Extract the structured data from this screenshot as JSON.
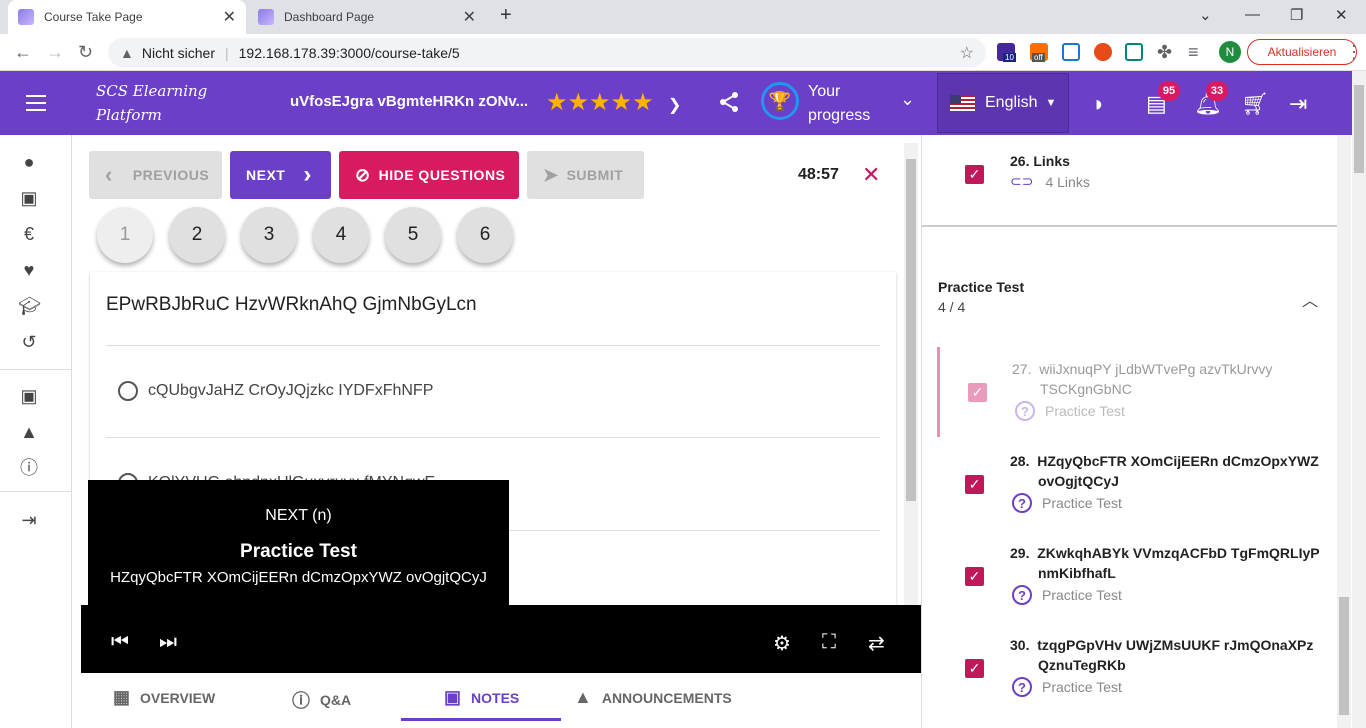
{
  "browser": {
    "tabs": [
      {
        "title": "Course Take Page",
        "active": true
      },
      {
        "title": "Dashboard Page",
        "active": false
      }
    ],
    "security": "Nicht sicher",
    "url": "192.168.178.39:3000/course-take/5",
    "update_label": "Aktualisieren",
    "profile_initial": "N",
    "ext_badge_1": "10",
    "ext_badge_2": "off"
  },
  "header": {
    "brand_line1": "SCS Elearning",
    "brand_line2": "Platform",
    "course_title": "uVfosEJgra vBgmteHRKn zONv...",
    "rating_stars": "★★★★★",
    "progress_line1": "Your",
    "progress_line2": "progress",
    "language": "English",
    "messages_count": "95",
    "notifications_count": "33"
  },
  "controls": {
    "previous_label": "PREVIOUS",
    "next_label": "NEXT",
    "hide_questions_label": "HIDE QUESTIONS",
    "submit_label": "SUBMIT",
    "timer": "48:57",
    "question_numbers": [
      "1",
      "2",
      "3",
      "4",
      "5",
      "6"
    ]
  },
  "question": {
    "title": "EPwRBJbRuC HzvWRknAhQ GjmNbGyLcn",
    "options": [
      "cQUbgvJaHZ CrOyJQjzkc IYDFxFhNFP",
      "KOlYVUG ebndnxUlGuxyruyx fMYNqwE"
    ]
  },
  "tooltip": {
    "shortcut": "NEXT (n)",
    "title": "Practice Test",
    "subtitle": "HZqyQbcFTR XOmCijEERn dCmzOpxYWZ ovOgjtQCyJ"
  },
  "bottom_tabs": [
    {
      "label": "OVERVIEW"
    },
    {
      "label": "Q&A"
    },
    {
      "label": "NOTES"
    },
    {
      "label": "ANNOUNCEMENTS"
    }
  ],
  "curriculum": {
    "prev_item": {
      "num": "26.",
      "title": "Links",
      "sub": "4  Links"
    },
    "section": {
      "title": "Practice Test",
      "count": "4 / 4"
    },
    "items": [
      {
        "num": "27.",
        "title_line1": "wiiJxnuqPY jLdbWTvePg azvTkUrvvy",
        "title_line2": "TSCKgnGbNC",
        "sub": "Practice Test"
      },
      {
        "num": "28.",
        "title_line1": "HZqyQbcFTR XOmCijEERn dCmzOpxYWZ",
        "title_line2": "ovOgjtQCyJ",
        "sub": "Practice Test"
      },
      {
        "num": "29.",
        "title_line1": "ZKwkqhABYk VVmzqACFbD TgFmQRLIyP",
        "title_line2": "nmKibfhafL",
        "sub": "Practice Test"
      },
      {
        "num": "30.",
        "title_line1": "tzqgPGpVHv UWjZMsUUKF rJmQOnaXPz",
        "title_line2": "QznuTegRKb",
        "sub": "Practice Test"
      }
    ]
  }
}
